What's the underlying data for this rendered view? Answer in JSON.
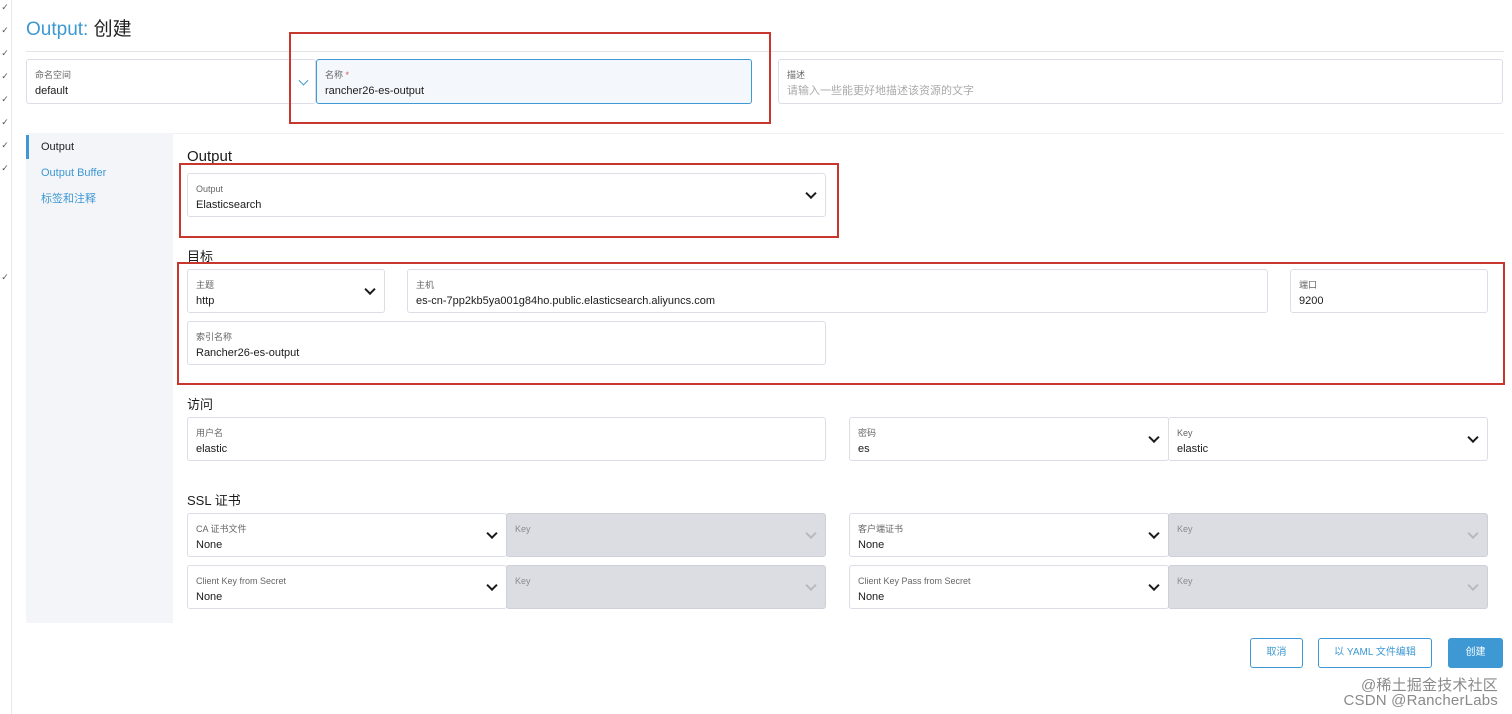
{
  "header": {
    "title_prefix": "Output:",
    "title_main": "创建"
  },
  "top_fields": {
    "namespace": {
      "label": "命名空间",
      "value": "default"
    },
    "name": {
      "label": "名称",
      "required": "*",
      "value": "rancher26-es-output"
    },
    "description": {
      "label": "描述",
      "placeholder": "请输入一些能更好地描述该资源的文字"
    }
  },
  "sidebar": {
    "items": [
      {
        "label": "Output"
      },
      {
        "label": "Output Buffer"
      },
      {
        "label": "标签和注释"
      }
    ]
  },
  "output_section": {
    "heading": "Output",
    "type_select": {
      "label": "Output",
      "value": "Elasticsearch"
    }
  },
  "target_section": {
    "heading": "目标",
    "scheme": {
      "label": "主题",
      "value": "http"
    },
    "host": {
      "label": "主机",
      "value": "es-cn-7pp2kb5ya001g84ho.public.elasticsearch.aliyuncs.com"
    },
    "port": {
      "label": "端口",
      "value": "9200"
    },
    "index": {
      "label": "索引名称",
      "value": "Rancher26-es-output"
    }
  },
  "access_section": {
    "heading": "访问",
    "username": {
      "label": "用户名",
      "value": "elastic"
    },
    "password": {
      "label": "密码",
      "value": "es"
    },
    "key": {
      "label": "Key",
      "value": "elastic"
    }
  },
  "ssl_section": {
    "heading": "SSL 证书",
    "ca_file": {
      "label": "CA 证书文件",
      "value": "None",
      "key_label": "Key"
    },
    "client_cert": {
      "label": "客户端证书",
      "value": "None",
      "key_label": "Key"
    },
    "client_key": {
      "label": "Client Key from Secret",
      "value": "None",
      "key_label": "Key"
    },
    "client_key_pass": {
      "label": "Client Key Pass from Secret",
      "value": "None",
      "key_label": "Key"
    }
  },
  "footer": {
    "cancel": "取消",
    "edit_yaml": "以 YAML 文件编辑",
    "create": "创建"
  },
  "watermark": {
    "line1": "@稀土掘金技术社区",
    "line2": "CSDN @RancherLabs"
  },
  "colors": {
    "accent": "#3d98d3",
    "highlight_box": "#c8372d",
    "disabled_field": "#dcdde3"
  }
}
